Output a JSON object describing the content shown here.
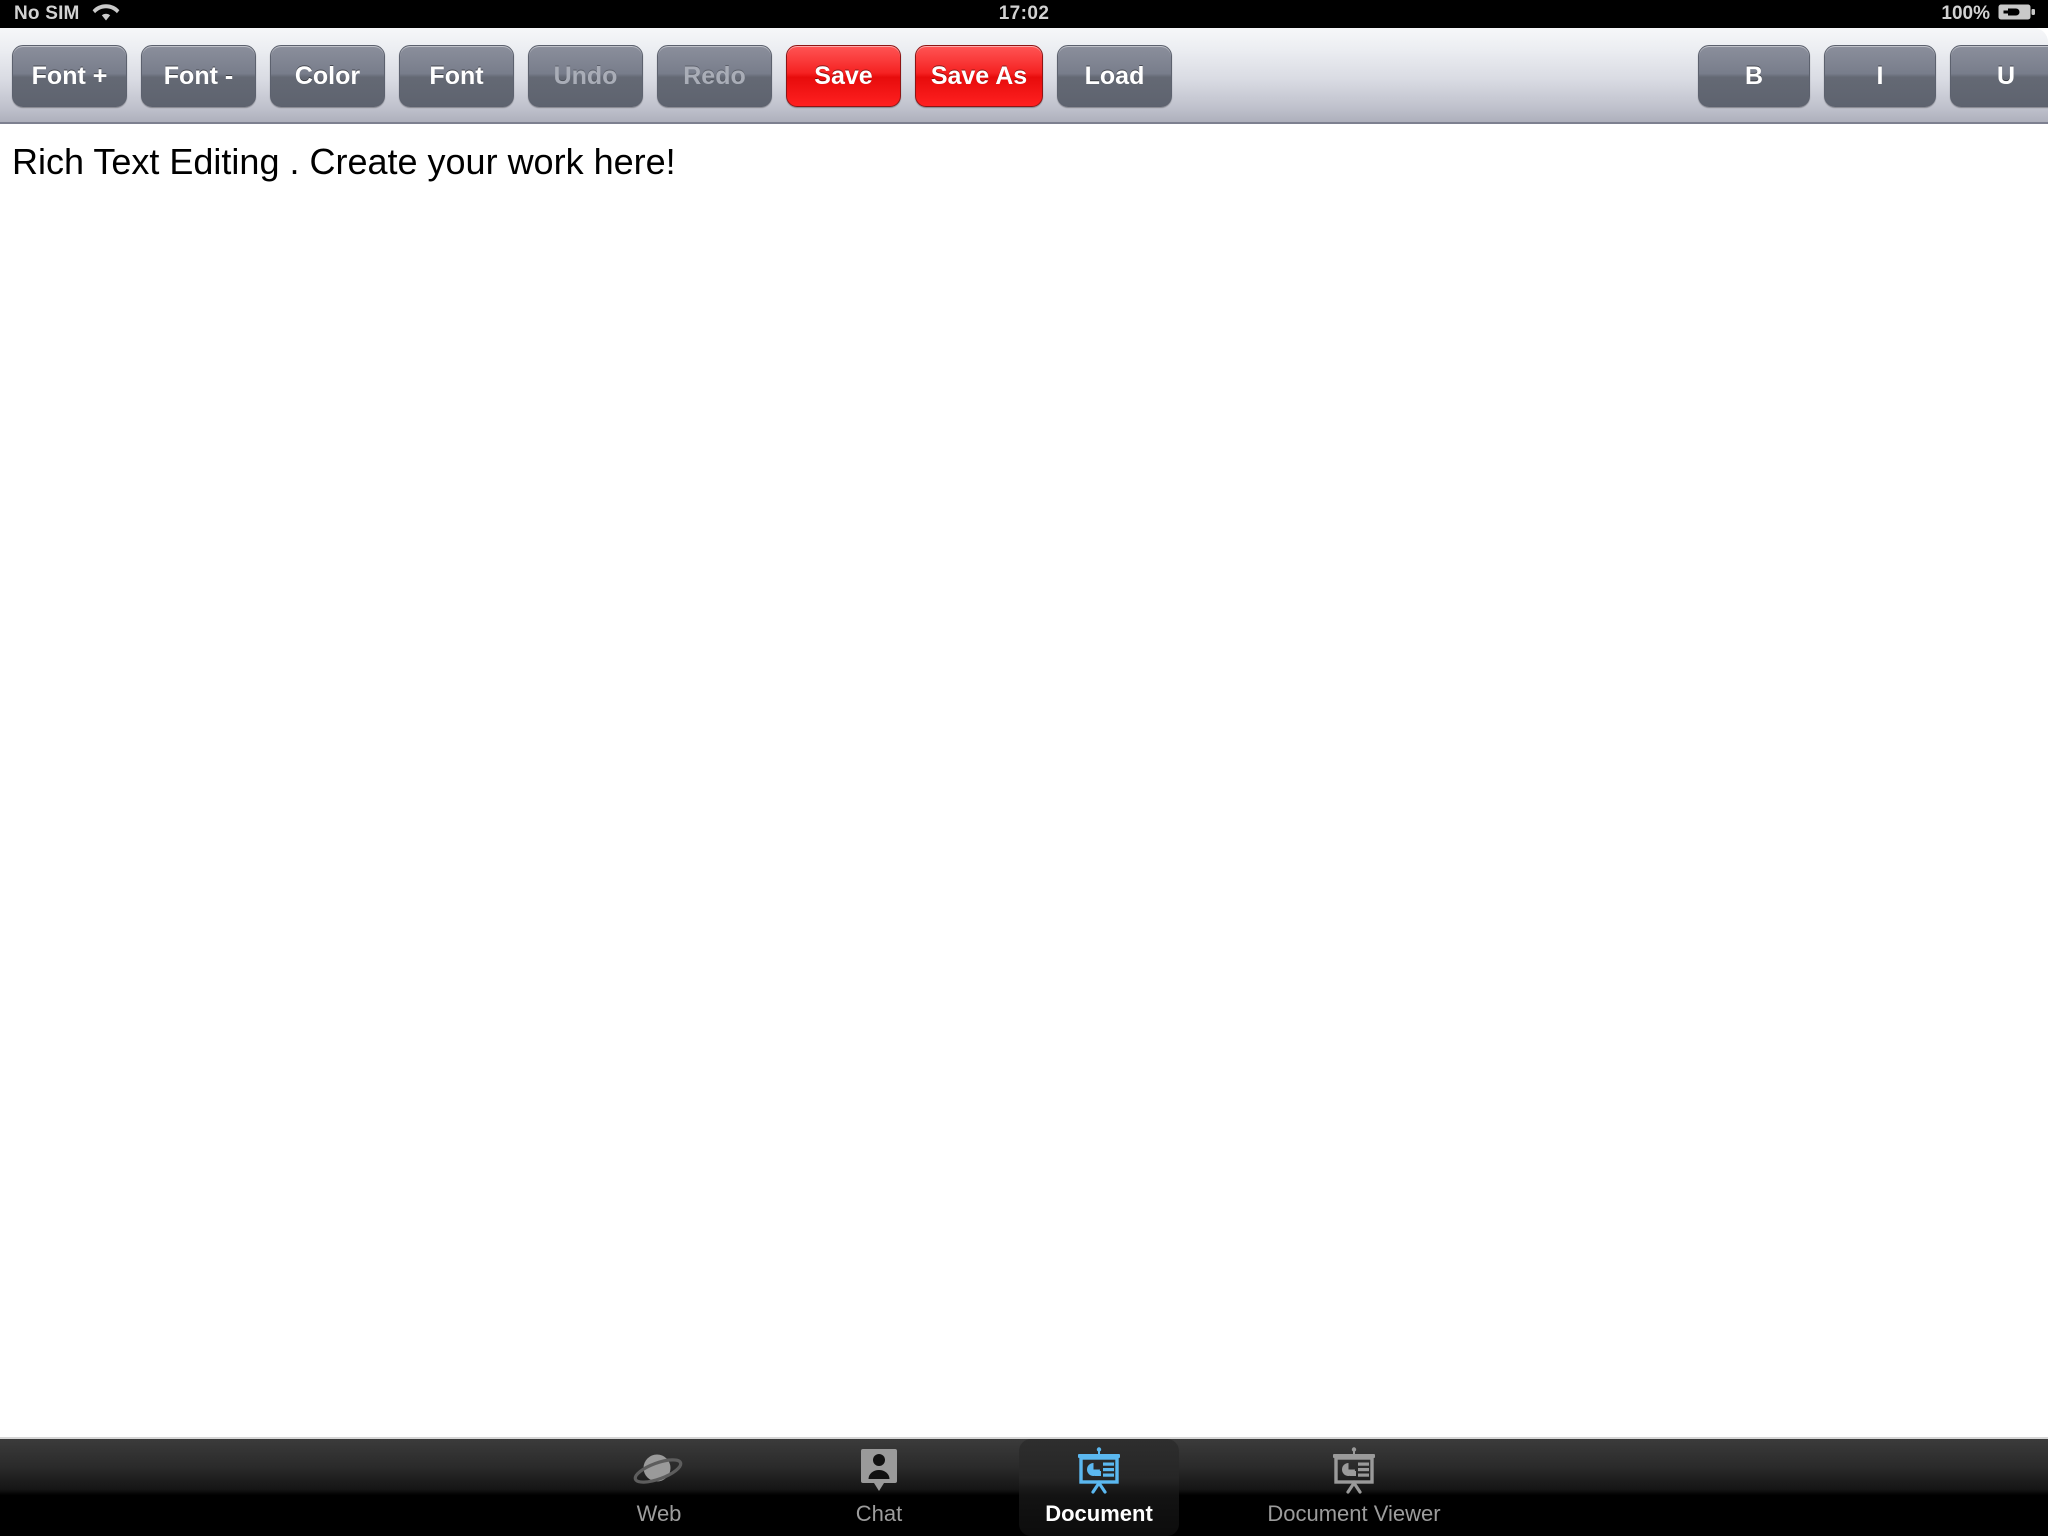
{
  "status_bar": {
    "carrier": "No SIM",
    "wifi_icon": "wifi-icon",
    "time": "17:02",
    "battery_percent": "100%",
    "battery_icon": "battery-charging-icon"
  },
  "toolbar": {
    "buttons": [
      {
        "label": "Font +",
        "name": "font-increase-button",
        "style": "default",
        "disabled": false
      },
      {
        "label": "Font -",
        "name": "font-decrease-button",
        "style": "default",
        "disabled": false
      },
      {
        "label": "Color",
        "name": "color-button",
        "style": "default",
        "disabled": false
      },
      {
        "label": "Font",
        "name": "font-button",
        "style": "default",
        "disabled": false
      },
      {
        "label": "Undo",
        "name": "undo-button",
        "style": "default",
        "disabled": true
      },
      {
        "label": "Redo",
        "name": "redo-button",
        "style": "default",
        "disabled": true
      },
      {
        "label": "Save",
        "name": "save-button",
        "style": "danger",
        "disabled": false
      },
      {
        "label": "Save As",
        "name": "save-as-button",
        "style": "danger",
        "disabled": false
      },
      {
        "label": "Load",
        "name": "load-button",
        "style": "default",
        "disabled": false
      }
    ],
    "format_buttons": [
      {
        "label": "B",
        "name": "bold-button",
        "active": false
      },
      {
        "label": "I",
        "name": "italic-button",
        "active": false
      },
      {
        "label": "U",
        "name": "underline-button",
        "active": false
      }
    ]
  },
  "document": {
    "content": "Rich Text Editing . Create your work here!"
  },
  "tab_bar": {
    "items": [
      {
        "label": "Web",
        "name": "tab-web",
        "icon": "planet-icon",
        "selected": false
      },
      {
        "label": "Chat",
        "name": "tab-chat",
        "icon": "person-bubble-icon",
        "selected": false
      },
      {
        "label": "Document",
        "name": "tab-document",
        "icon": "presentation-icon",
        "selected": true
      },
      {
        "label": "Document Viewer",
        "name": "tab-document-viewer",
        "icon": "presentation-icon",
        "selected": false
      }
    ]
  },
  "colors": {
    "accent_red": "#f52222",
    "selected_tab_icon": "#5bb8f0",
    "toolbar_top": "#f6f7f9",
    "toolbar_bottom": "#aeb0bc",
    "status_bar_bg": "#000000"
  }
}
